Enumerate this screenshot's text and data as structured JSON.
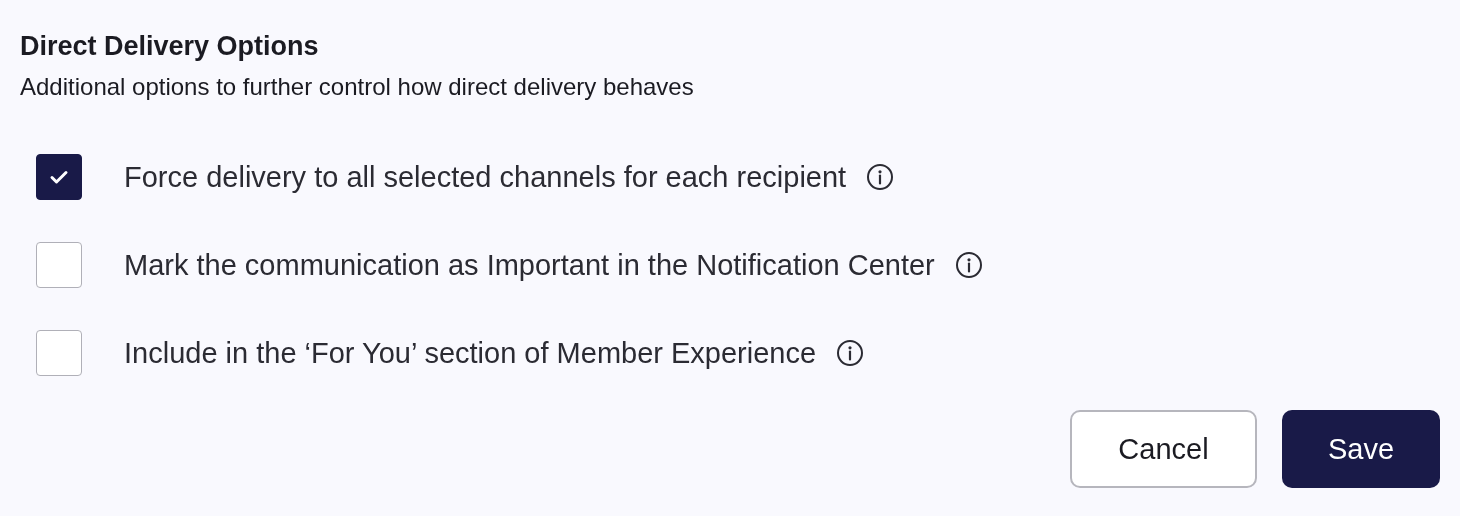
{
  "section": {
    "title": "Direct Delivery Options",
    "description": "Additional options to further control how direct delivery behaves"
  },
  "options": [
    {
      "label": "Force delivery to all selected channels for each recipient",
      "checked": true
    },
    {
      "label": "Mark the communication as Important in the Notification Center",
      "checked": false
    },
    {
      "label": "Include in the ‘For You’ section of Member Experience",
      "checked": false
    }
  ],
  "buttons": [
    {
      "label": "Cancel",
      "kind": "secondary"
    },
    {
      "label": "Save",
      "kind": "primary"
    }
  ]
}
